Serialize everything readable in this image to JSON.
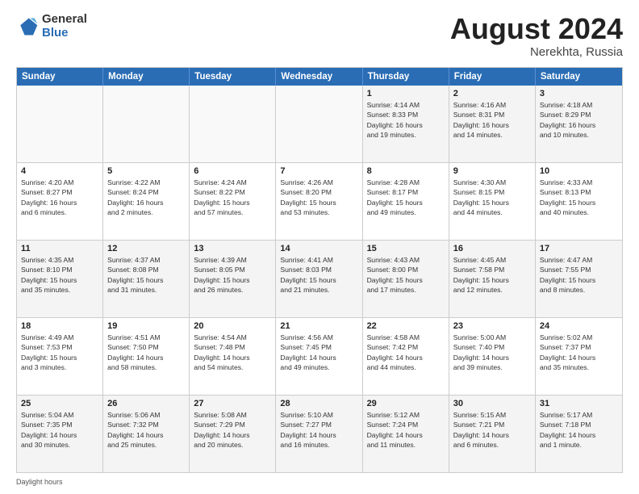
{
  "logo": {
    "general": "General",
    "blue": "Blue"
  },
  "title": {
    "month_year": "August 2024",
    "location": "Nerekhta, Russia"
  },
  "header_days": [
    "Sunday",
    "Monday",
    "Tuesday",
    "Wednesday",
    "Thursday",
    "Friday",
    "Saturday"
  ],
  "weeks": [
    [
      {
        "day": "",
        "info": "",
        "empty": true
      },
      {
        "day": "",
        "info": "",
        "empty": true
      },
      {
        "day": "",
        "info": "",
        "empty": true
      },
      {
        "day": "",
        "info": "",
        "empty": true
      },
      {
        "day": "1",
        "info": "Sunrise: 4:14 AM\nSunset: 8:33 PM\nDaylight: 16 hours\nand 19 minutes."
      },
      {
        "day": "2",
        "info": "Sunrise: 4:16 AM\nSunset: 8:31 PM\nDaylight: 16 hours\nand 14 minutes."
      },
      {
        "day": "3",
        "info": "Sunrise: 4:18 AM\nSunset: 8:29 PM\nDaylight: 16 hours\nand 10 minutes."
      }
    ],
    [
      {
        "day": "4",
        "info": "Sunrise: 4:20 AM\nSunset: 8:27 PM\nDaylight: 16 hours\nand 6 minutes."
      },
      {
        "day": "5",
        "info": "Sunrise: 4:22 AM\nSunset: 8:24 PM\nDaylight: 16 hours\nand 2 minutes."
      },
      {
        "day": "6",
        "info": "Sunrise: 4:24 AM\nSunset: 8:22 PM\nDaylight: 15 hours\nand 57 minutes."
      },
      {
        "day": "7",
        "info": "Sunrise: 4:26 AM\nSunset: 8:20 PM\nDaylight: 15 hours\nand 53 minutes."
      },
      {
        "day": "8",
        "info": "Sunrise: 4:28 AM\nSunset: 8:17 PM\nDaylight: 15 hours\nand 49 minutes."
      },
      {
        "day": "9",
        "info": "Sunrise: 4:30 AM\nSunset: 8:15 PM\nDaylight: 15 hours\nand 44 minutes."
      },
      {
        "day": "10",
        "info": "Sunrise: 4:33 AM\nSunset: 8:13 PM\nDaylight: 15 hours\nand 40 minutes."
      }
    ],
    [
      {
        "day": "11",
        "info": "Sunrise: 4:35 AM\nSunset: 8:10 PM\nDaylight: 15 hours\nand 35 minutes."
      },
      {
        "day": "12",
        "info": "Sunrise: 4:37 AM\nSunset: 8:08 PM\nDaylight: 15 hours\nand 31 minutes."
      },
      {
        "day": "13",
        "info": "Sunrise: 4:39 AM\nSunset: 8:05 PM\nDaylight: 15 hours\nand 26 minutes."
      },
      {
        "day": "14",
        "info": "Sunrise: 4:41 AM\nSunset: 8:03 PM\nDaylight: 15 hours\nand 21 minutes."
      },
      {
        "day": "15",
        "info": "Sunrise: 4:43 AM\nSunset: 8:00 PM\nDaylight: 15 hours\nand 17 minutes."
      },
      {
        "day": "16",
        "info": "Sunrise: 4:45 AM\nSunset: 7:58 PM\nDaylight: 15 hours\nand 12 minutes."
      },
      {
        "day": "17",
        "info": "Sunrise: 4:47 AM\nSunset: 7:55 PM\nDaylight: 15 hours\nand 8 minutes."
      }
    ],
    [
      {
        "day": "18",
        "info": "Sunrise: 4:49 AM\nSunset: 7:53 PM\nDaylight: 15 hours\nand 3 minutes."
      },
      {
        "day": "19",
        "info": "Sunrise: 4:51 AM\nSunset: 7:50 PM\nDaylight: 14 hours\nand 58 minutes."
      },
      {
        "day": "20",
        "info": "Sunrise: 4:54 AM\nSunset: 7:48 PM\nDaylight: 14 hours\nand 54 minutes."
      },
      {
        "day": "21",
        "info": "Sunrise: 4:56 AM\nSunset: 7:45 PM\nDaylight: 14 hours\nand 49 minutes."
      },
      {
        "day": "22",
        "info": "Sunrise: 4:58 AM\nSunset: 7:42 PM\nDaylight: 14 hours\nand 44 minutes."
      },
      {
        "day": "23",
        "info": "Sunrise: 5:00 AM\nSunset: 7:40 PM\nDaylight: 14 hours\nand 39 minutes."
      },
      {
        "day": "24",
        "info": "Sunrise: 5:02 AM\nSunset: 7:37 PM\nDaylight: 14 hours\nand 35 minutes."
      }
    ],
    [
      {
        "day": "25",
        "info": "Sunrise: 5:04 AM\nSunset: 7:35 PM\nDaylight: 14 hours\nand 30 minutes."
      },
      {
        "day": "26",
        "info": "Sunrise: 5:06 AM\nSunset: 7:32 PM\nDaylight: 14 hours\nand 25 minutes."
      },
      {
        "day": "27",
        "info": "Sunrise: 5:08 AM\nSunset: 7:29 PM\nDaylight: 14 hours\nand 20 minutes."
      },
      {
        "day": "28",
        "info": "Sunrise: 5:10 AM\nSunset: 7:27 PM\nDaylight: 14 hours\nand 16 minutes."
      },
      {
        "day": "29",
        "info": "Sunrise: 5:12 AM\nSunset: 7:24 PM\nDaylight: 14 hours\nand 11 minutes."
      },
      {
        "day": "30",
        "info": "Sunrise: 5:15 AM\nSunset: 7:21 PM\nDaylight: 14 hours\nand 6 minutes."
      },
      {
        "day": "31",
        "info": "Sunrise: 5:17 AM\nSunset: 7:18 PM\nDaylight: 14 hours\nand 1 minute."
      }
    ]
  ],
  "footer": {
    "daylight_label": "Daylight hours"
  }
}
